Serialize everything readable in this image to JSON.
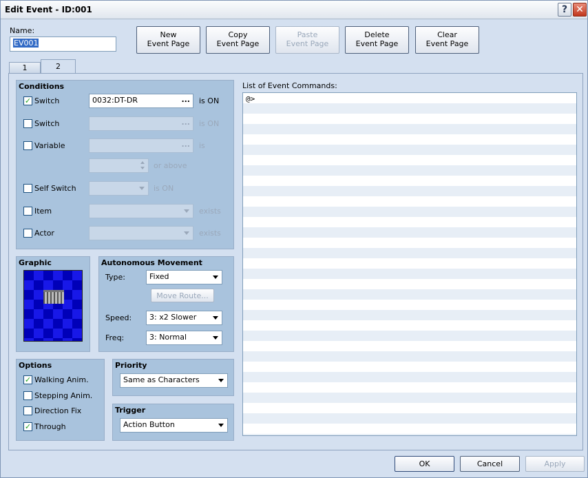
{
  "window": {
    "title": "Edit Event - ID:001",
    "help_glyph": "?",
    "close_glyph": "✕"
  },
  "name": {
    "label": "Name:",
    "value": "EV001"
  },
  "page_buttons": {
    "new": [
      "New",
      "Event Page"
    ],
    "copy": [
      "Copy",
      "Event Page"
    ],
    "paste": [
      "Paste",
      "Event Page"
    ],
    "delete": [
      "Delete",
      "Event Page"
    ],
    "clear": [
      "Clear",
      "Event Page"
    ]
  },
  "tabs": [
    "1",
    "2"
  ],
  "conditions": {
    "title": "Conditions",
    "switch1": {
      "label": "Switch",
      "checked": true,
      "value": "0032:DT-DR",
      "suffix": "is ON"
    },
    "switch2": {
      "label": "Switch",
      "checked": false,
      "value": "",
      "suffix": "is ON"
    },
    "variable": {
      "label": "Variable",
      "checked": false,
      "value": "",
      "suffix": "is",
      "above": "or above"
    },
    "self_switch": {
      "label": "Self Switch",
      "checked": false,
      "suffix": "is ON"
    },
    "item": {
      "label": "Item",
      "checked": false,
      "suffix": "exists"
    },
    "actor": {
      "label": "Actor",
      "checked": false,
      "suffix": "exists"
    },
    "ellipsis": "..."
  },
  "graphic": {
    "title": "Graphic"
  },
  "autonomous": {
    "title": "Autonomous Movement",
    "type_label": "Type:",
    "type_value": "Fixed",
    "move_route": "Move Route...",
    "speed_label": "Speed:",
    "speed_value": "3: x2 Slower",
    "freq_label": "Freq:",
    "freq_value": "3: Normal"
  },
  "options": {
    "title": "Options",
    "walking": {
      "label": "Walking Anim.",
      "checked": true
    },
    "stepping": {
      "label": "Stepping Anim.",
      "checked": false
    },
    "direction_fix": {
      "label": "Direction Fix",
      "checked": false
    },
    "through": {
      "label": "Through",
      "checked": true
    }
  },
  "priority": {
    "title": "Priority",
    "value": "Same as Characters"
  },
  "trigger": {
    "title": "Trigger",
    "value": "Action Button"
  },
  "commands": {
    "title": "List of Event Commands:",
    "rows": [
      "@>"
    ]
  },
  "footer": {
    "ok": "OK",
    "cancel": "Cancel",
    "apply": "Apply"
  },
  "check_glyph": "✓"
}
